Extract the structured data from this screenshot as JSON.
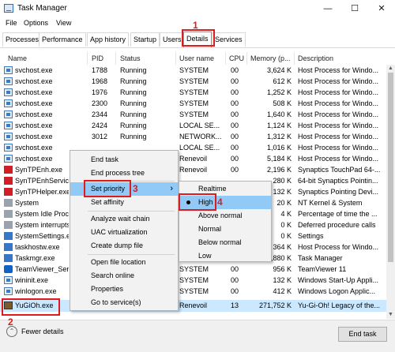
{
  "window": {
    "title": "Task Manager",
    "minimize": "—",
    "maximize": "☐",
    "close": "✕"
  },
  "menubar": [
    "File",
    "Options",
    "View"
  ],
  "tabs": [
    "Processes",
    "Performance",
    "App history",
    "Startup",
    "Users",
    "Details",
    "Services"
  ],
  "active_tab": "Details",
  "columns": [
    "Name",
    "PID",
    "Status",
    "User name",
    "CPU",
    "Memory (p...",
    "Description"
  ],
  "rows": [
    {
      "icon": "service-icon",
      "name": "svchost.exe",
      "pid": "1788",
      "status": "Running",
      "user": "SYSTEM",
      "cpu": "00",
      "mem": "3,624 K",
      "desc": "Host Process for Windo..."
    },
    {
      "icon": "service-icon",
      "name": "svchost.exe",
      "pid": "1968",
      "status": "Running",
      "user": "SYSTEM",
      "cpu": "00",
      "mem": "612 K",
      "desc": "Host Process for Windo..."
    },
    {
      "icon": "service-icon",
      "name": "svchost.exe",
      "pid": "1976",
      "status": "Running",
      "user": "SYSTEM",
      "cpu": "00",
      "mem": "1,252 K",
      "desc": "Host Process for Windo..."
    },
    {
      "icon": "service-icon",
      "name": "svchost.exe",
      "pid": "2300",
      "status": "Running",
      "user": "SYSTEM",
      "cpu": "00",
      "mem": "508 K",
      "desc": "Host Process for Windo..."
    },
    {
      "icon": "service-icon",
      "name": "svchost.exe",
      "pid": "2344",
      "status": "Running",
      "user": "SYSTEM",
      "cpu": "00",
      "mem": "1,640 K",
      "desc": "Host Process for Windo..."
    },
    {
      "icon": "service-icon",
      "name": "svchost.exe",
      "pid": "2424",
      "status": "Running",
      "user": "LOCAL SE...",
      "cpu": "00",
      "mem": "1,124 K",
      "desc": "Host Process for Windo..."
    },
    {
      "icon": "service-icon",
      "name": "svchost.exe",
      "pid": "3012",
      "status": "Running",
      "user": "NETWORK...",
      "cpu": "00",
      "mem": "1,312 K",
      "desc": "Host Process for Windo..."
    },
    {
      "icon": "service-icon",
      "name": "svchost.exe",
      "pid": "",
      "status": "",
      "user": "LOCAL SE...",
      "cpu": "00",
      "mem": "1,016 K",
      "desc": "Host Process for Windo..."
    },
    {
      "icon": "service-icon",
      "name": "svchost.exe",
      "pid": "",
      "status": "",
      "user": "Renevoil",
      "cpu": "00",
      "mem": "5,184 K",
      "desc": "Host Process for Windo..."
    },
    {
      "icon": "red-icon",
      "name": "SynTPEnh.exe",
      "pid": "",
      "status": "",
      "user": "Renevoil",
      "cpu": "00",
      "mem": "2,196 K",
      "desc": "Synaptics TouchPad 64-..."
    },
    {
      "icon": "red-icon",
      "name": "SynTPEnhService",
      "pid": "",
      "status": "",
      "user": "",
      "cpu": "",
      "mem": "280 K",
      "desc": "64-bit Synaptics Pointin..."
    },
    {
      "icon": "red-icon",
      "name": "SynTPHelper.exe",
      "pid": "",
      "status": "",
      "user": "",
      "cpu": "",
      "mem": "132 K",
      "desc": "Synaptics Pointing Devi..."
    },
    {
      "icon": "gray-icon",
      "name": "System",
      "pid": "",
      "status": "",
      "user": "",
      "cpu": "",
      "mem": "20 K",
      "desc": "NT Kernel & System"
    },
    {
      "icon": "gray-icon",
      "name": "System Idle Proc",
      "pid": "",
      "status": "",
      "user": "",
      "cpu": "",
      "mem": "4 K",
      "desc": "Percentage of time the ..."
    },
    {
      "icon": "gray-icon",
      "name": "System interrupts",
      "pid": "",
      "status": "",
      "user": "",
      "cpu": "",
      "mem": "0 K",
      "desc": "Deferred procedure calls"
    },
    {
      "icon": "blue-icon",
      "name": "SystemSettings.ex",
      "pid": "",
      "status": "",
      "user": "",
      "cpu": "",
      "mem": "0 K",
      "desc": "Settings"
    },
    {
      "icon": "blue-icon",
      "name": "taskhostw.exe",
      "pid": "",
      "status": "",
      "user": "",
      "cpu": "",
      "mem": "364 K",
      "desc": "Host Process for Windo..."
    },
    {
      "icon": "blue-icon",
      "name": "Taskmgr.exe",
      "pid": "",
      "status": "",
      "user": "",
      "cpu": "02",
      "mem": "10,880 K",
      "desc": "Task Manager"
    },
    {
      "icon": "teamviewer-icon",
      "name": "TeamViewer_Servi",
      "pid": "",
      "status": "",
      "user": "SYSTEM",
      "cpu": "00",
      "mem": "956 K",
      "desc": "TeamViewer 11"
    },
    {
      "icon": "service-icon",
      "name": "wininit.exe",
      "pid": "",
      "status": "",
      "user": "SYSTEM",
      "cpu": "00",
      "mem": "132 K",
      "desc": "Windows Start-Up Appli..."
    },
    {
      "icon": "service-icon",
      "name": "winlogon.exe",
      "pid": "",
      "status": "",
      "user": "SYSTEM",
      "cpu": "00",
      "mem": "412 K",
      "desc": "Windows Logon Applic..."
    },
    {
      "icon": "yugioh-icon",
      "name": "YuGiOh.exe",
      "pid": "",
      "status": "",
      "user": "Renevoil",
      "cpu": "13",
      "mem": "271,752 K",
      "desc": "Yu-Gi-Oh! Legacy of the..."
    }
  ],
  "context_menu": [
    "End task",
    "End process tree",
    "Set priority",
    "Set affinity",
    "Analyze wait chain",
    "UAC virtualization",
    "Create dump file",
    "Open file location",
    "Search online",
    "Properties",
    "Go to service(s)"
  ],
  "priority_menu": [
    "Realtime",
    "High",
    "Above normal",
    "Normal",
    "Below normal",
    "Low"
  ],
  "selected_priority": "High",
  "submenu_arrow": "›",
  "footer": {
    "fewer_details": "Fewer details",
    "end_task": "End task"
  },
  "annotations": [
    "1",
    "2",
    "3",
    "4"
  ]
}
